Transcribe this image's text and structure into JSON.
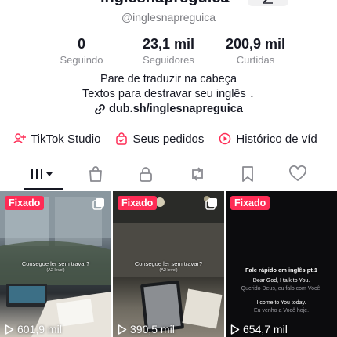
{
  "profile": {
    "username": "inglesnapreguica",
    "handle": "@inglesnapreguica"
  },
  "stats": [
    {
      "value": "0",
      "label": "Seguindo"
    },
    {
      "value": "23,1 mil",
      "label": "Seguidores"
    },
    {
      "value": "200,9 mil",
      "label": "Curtidas"
    }
  ],
  "bio": {
    "line1": "Pare de traduzir na cabeça",
    "line2": "Textos para destravar seu inglês ↓",
    "link": "dub.sh/inglesnapreguica"
  },
  "quick_links": [
    {
      "label": "TikTok Studio",
      "icon": "studio-icon"
    },
    {
      "label": "Seus pedidos",
      "icon": "orders-bag-icon"
    },
    {
      "label": "Histórico de víd",
      "icon": "history-play-icon"
    }
  ],
  "tabs": [
    {
      "name": "videos-grid",
      "icon": "grid-icon"
    },
    {
      "name": "shop",
      "icon": "shopping-bag-icon"
    },
    {
      "name": "private",
      "icon": "lock-icon"
    },
    {
      "name": "reposts",
      "icon": "repost-icon"
    },
    {
      "name": "favorites",
      "icon": "bookmark-icon"
    },
    {
      "name": "liked",
      "icon": "heart-icon"
    }
  ],
  "videos": [
    {
      "badge": "Fixado",
      "caption": "Consegue ler sem travar?",
      "sub": "(A2 level)",
      "views": "601,9 mil"
    },
    {
      "badge": "Fixado",
      "caption": "Consegue ler sem travar?",
      "sub": "(A2 level)",
      "views": "390,5 mil"
    },
    {
      "badge": "Fixado",
      "caption": "Fale rápido em inglês pt.1",
      "line1": "Dear God, I talk to You.",
      "line2": "Querido Deus, eu falo com Você.",
      "line3": "I come to You today.",
      "line4": "Eu venho a Você hoje.",
      "views": "654,7 mil"
    }
  ],
  "colors": {
    "accent": "#fe2c55",
    "text": "#161823",
    "muted": "#8a8b91"
  }
}
